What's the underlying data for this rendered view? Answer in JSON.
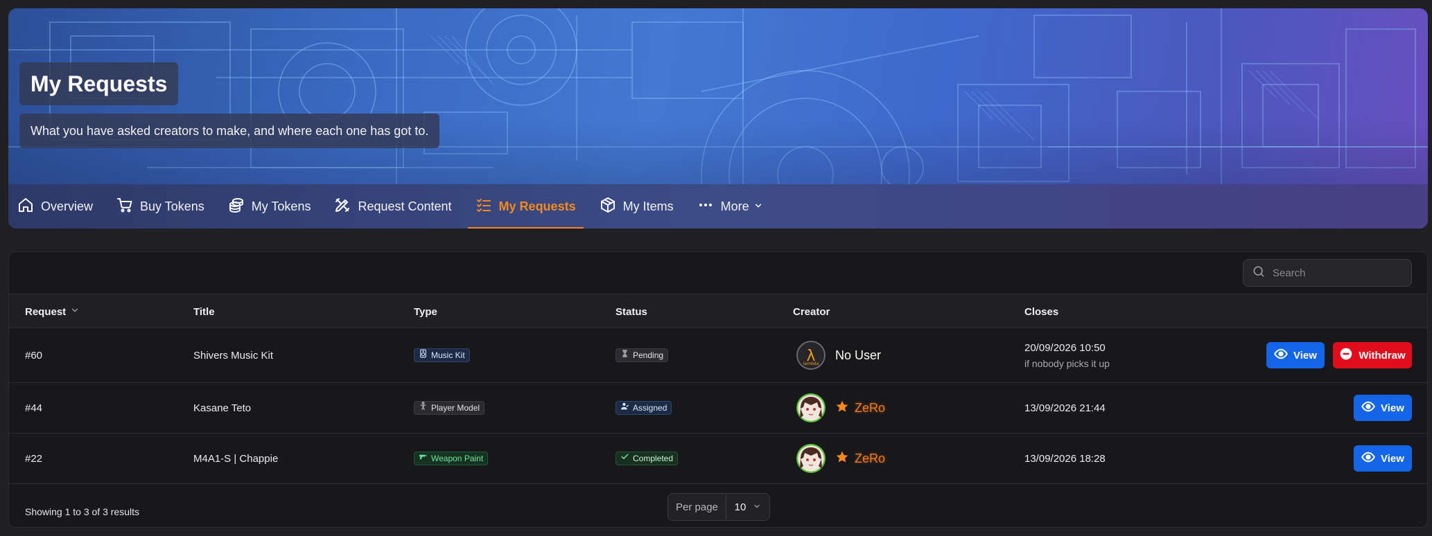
{
  "header": {
    "title": "My Requests",
    "subtitle": "What you have asked creators to make, and where each one has got to."
  },
  "nav": [
    {
      "label": "Overview",
      "icon": "home-icon"
    },
    {
      "label": "Buy Tokens",
      "icon": "cart-icon"
    },
    {
      "label": "My Tokens",
      "icon": "coins-icon"
    },
    {
      "label": "Request Content",
      "icon": "pencil-ruler-icon"
    },
    {
      "label": "My Requests",
      "icon": "list-checks-icon",
      "active": true
    },
    {
      "label": "My Items",
      "icon": "box-icon"
    },
    {
      "label": "More",
      "icon": "ellipsis-icon"
    }
  ],
  "search": {
    "placeholder": "Search"
  },
  "table": {
    "columns": [
      "Request",
      "Title",
      "Type",
      "Status",
      "Creator",
      "Closes"
    ],
    "sort_column": "Request",
    "rows": [
      {
        "request": "#60",
        "title": "Shivers Music Kit",
        "type": "Music Kit",
        "status": "Pending",
        "creator": "No User",
        "closes": "20/09/2026 10:50",
        "closes_note": "if nobody picks it up",
        "actions": [
          "View",
          "Withdraw"
        ]
      },
      {
        "request": "#44",
        "title": "Kasane Teto",
        "type": "Player Model",
        "status": "Assigned",
        "creator": "ZeRo",
        "closes": "13/09/2026 21:44",
        "actions": [
          "View"
        ]
      },
      {
        "request": "#22",
        "title": "M4A1-S | Chappie",
        "type": "Weapon Paint",
        "status": "Completed",
        "creator": "ZeRo",
        "closes": "13/09/2026 18:28",
        "actions": [
          "View"
        ]
      }
    ]
  },
  "footer": {
    "summary": "Showing 1 to 3 of 3 results",
    "per_page_label": "Per page",
    "per_page_value": "10"
  },
  "colors": {
    "accent": "#f5891f",
    "primary_button": "#1565e8",
    "danger_button": "#e10d1d"
  }
}
